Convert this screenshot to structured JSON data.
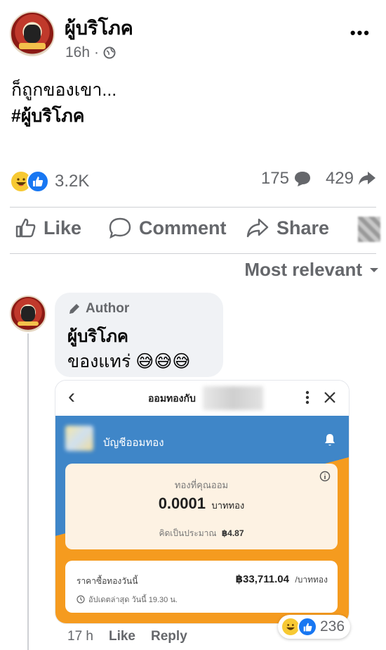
{
  "post": {
    "page_name": "ผู้บริโภค",
    "time": "16h",
    "meta_sep": "·",
    "body_line": "ก็ถูกของเขา...",
    "hashtag": "#ผู้บริโภค",
    "more_label": "•••"
  },
  "stats": {
    "reactions": "3.2K",
    "comments": "175",
    "shares": "429"
  },
  "actions": {
    "like": "Like",
    "comment": "Comment",
    "share": "Share"
  },
  "sort": {
    "label": "Most relevant"
  },
  "comment": {
    "badge": "Author",
    "name": "ผู้บริโภค",
    "text": "ของแทร่ 😅😅😅",
    "time": "17 h",
    "like": "Like",
    "reply": "Reply",
    "reactions": "236"
  },
  "screenshot": {
    "back_glyph": "‹",
    "title": "ออมทองกับ",
    "account": "บัญชีออมทอง",
    "saved_label": "ทองที่คุณออม",
    "amount": "0.0001",
    "unit": "บาททอง",
    "value_label": "คิดเป็นประมาณ",
    "value": "฿4.87",
    "price_label": "ราคาซื้อทองวันนี้",
    "price": "฿33,711.04",
    "price_unit": "/บาททอง",
    "updated": "อัปเดตล่าสุด วันนี้ 19.30 น."
  },
  "colors": {
    "accent": "#1877f2",
    "muted": "#65676b",
    "app_blue": "#3f86c8",
    "app_orange": "#f59b1f"
  }
}
